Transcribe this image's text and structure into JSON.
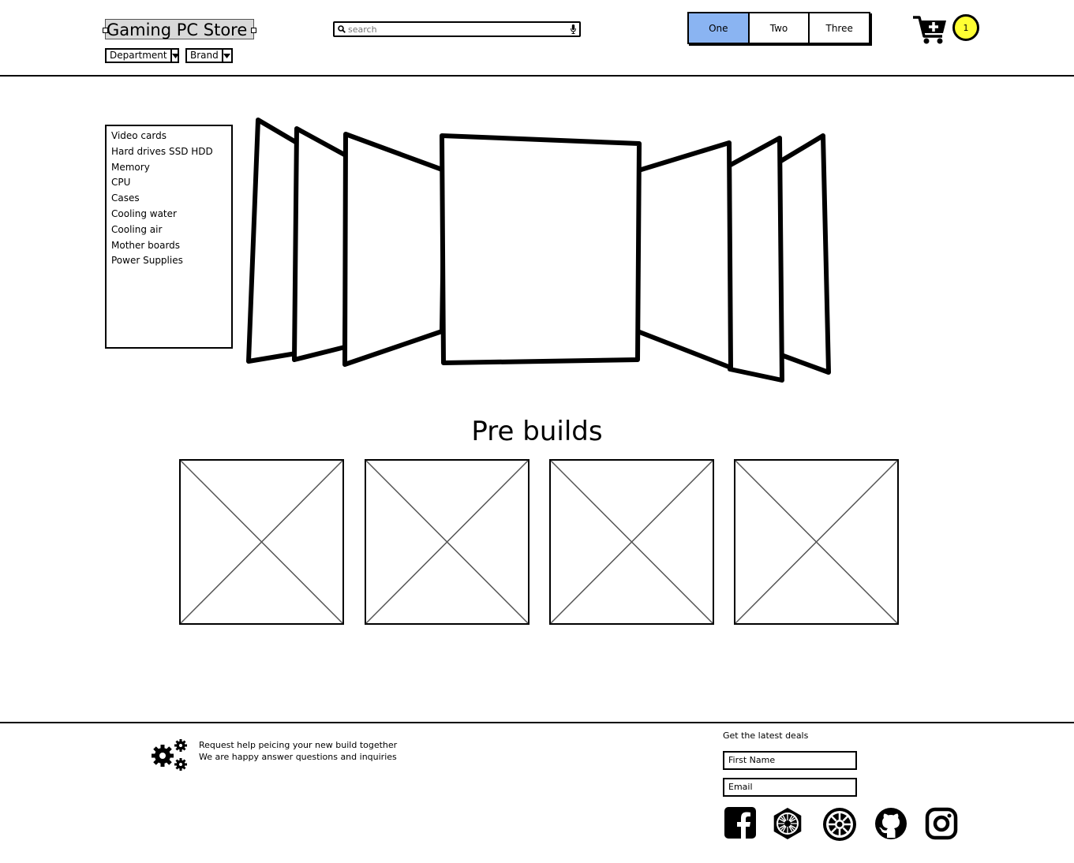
{
  "header": {
    "logo": "Gaming PC Store",
    "filters": [
      {
        "label": "Department"
      },
      {
        "label": "Brand"
      }
    ],
    "search": {
      "placeholder": "search",
      "value": ""
    },
    "tabs": [
      {
        "label": "One",
        "active": true
      },
      {
        "label": "Two",
        "active": false
      },
      {
        "label": "Three",
        "active": false
      }
    ],
    "cart": {
      "icon": "cart-add-icon",
      "count": "1"
    }
  },
  "sidebar": {
    "items": [
      {
        "label": "Video cards"
      },
      {
        "label": "Hard drives SSD HDD"
      },
      {
        "label": "Memory"
      },
      {
        "label": "CPU"
      },
      {
        "label": "Cases"
      },
      {
        "label": "Cooling water"
      },
      {
        "label": "Cooling air"
      },
      {
        "label": "Mother boards"
      },
      {
        "label": "Power Supplies"
      }
    ]
  },
  "carousel": {
    "icon": "cover-flow-carousel"
  },
  "prebuilds": {
    "title": "Pre builds",
    "items": [
      {
        "icon": "image-placeholder-icon"
      },
      {
        "icon": "image-placeholder-icon"
      },
      {
        "icon": "image-placeholder-icon"
      },
      {
        "icon": "image-placeholder-icon"
      }
    ]
  },
  "footer": {
    "help_line1": "Request help peicing your new build together",
    "help_line2": "We are happy answer questions and inquiries",
    "newsletter": {
      "heading": "Get the latest deals",
      "first_name_placeholder": "First Name",
      "email_placeholder": "Email"
    },
    "social": [
      {
        "icon": "facebook-icon"
      },
      {
        "icon": "first-order-icon"
      },
      {
        "icon": "galactic-empire-icon"
      },
      {
        "icon": "github-icon"
      },
      {
        "icon": "instagram-icon"
      }
    ]
  },
  "colors": {
    "tab_active": "#8ab4f2",
    "badge": "#ffff33",
    "logo_bg": "#d9d9d9"
  }
}
